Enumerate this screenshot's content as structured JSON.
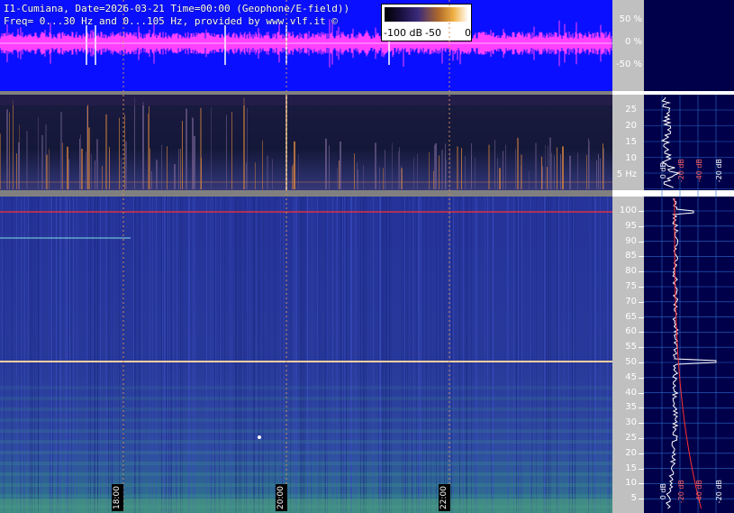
{
  "header": {
    "title_line1": "I1-Cumiana, Date=2026-03-21 Time=00:00 (Geophone/E-field))",
    "title_line2": "Freq= 0...30 Hz and 0...105 Hz, provided by www.vlf.it ©"
  },
  "color_scale": {
    "labels": [
      "-100 dB",
      "-50",
      "0"
    ]
  },
  "waveform_axis": {
    "ticks": [
      "50 %",
      "0 %",
      "-50 %"
    ]
  },
  "low_freq_axis": {
    "ticks": [
      "25",
      "20",
      "15",
      "10",
      "5 Hz"
    ]
  },
  "high_freq_axis": {
    "ticks": [
      "100",
      "95",
      "90",
      "85",
      "80",
      "75",
      "70",
      "65",
      "60",
      "55",
      "50",
      "45",
      "40",
      "35",
      "30",
      "25",
      "20",
      "15",
      "10",
      "5"
    ]
  },
  "time_axis": {
    "labels": [
      "18:00",
      "20:00",
      "22:00"
    ]
  },
  "side_panel_top": {
    "labels": [
      "0 dB",
      "-20 dB",
      "-40 dB",
      "-20 dB"
    ]
  },
  "side_panel_bottom": {
    "labels": [
      "0 dB",
      "-20 dB",
      "-40 dB",
      "-20 dB"
    ]
  },
  "colors": {
    "waveform_bg": "#0a10ff",
    "waveform_trace": "#ff40ff",
    "spectrogram_bg": "#1e2a7a",
    "axis_panel": "#c0c0c0",
    "side_panel_bg": "#00004a",
    "mark_line": "#ff3030"
  }
}
